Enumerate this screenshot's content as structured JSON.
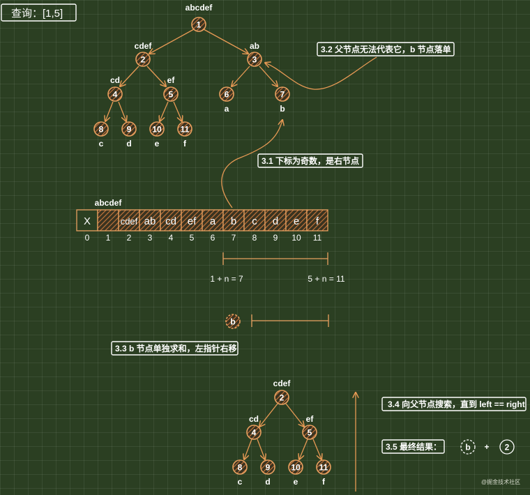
{
  "title": "查询：[1,5]",
  "tree_main": {
    "nodes": [
      {
        "id": "1",
        "label": "abcdef"
      },
      {
        "id": "2",
        "label": "cdef"
      },
      {
        "id": "3",
        "label": "ab"
      },
      {
        "id": "4",
        "label": "cd"
      },
      {
        "id": "5",
        "label": "ef"
      },
      {
        "id": "6",
        "label": "a"
      },
      {
        "id": "7",
        "label": "b"
      },
      {
        "id": "8",
        "label": "c"
      },
      {
        "id": "9",
        "label": "d"
      },
      {
        "id": "10",
        "label": "e"
      },
      {
        "id": "11",
        "label": "f"
      }
    ]
  },
  "array": {
    "cells": [
      {
        "value": "X",
        "index": "0"
      },
      {
        "value": "",
        "index": "1",
        "label_above": "abcdef"
      },
      {
        "value": "cdef",
        "index": "2"
      },
      {
        "value": "ab",
        "index": "3"
      },
      {
        "value": "cd",
        "index": "4"
      },
      {
        "value": "ef",
        "index": "5"
      },
      {
        "value": "a",
        "index": "6"
      },
      {
        "value": "b",
        "index": "7"
      },
      {
        "value": "c",
        "index": "8"
      },
      {
        "value": "d",
        "index": "9"
      },
      {
        "value": "e",
        "index": "10"
      },
      {
        "value": "f",
        "index": "11"
      }
    ]
  },
  "range": {
    "left_label": "1 + n = 7",
    "right_label": "5 + n = 11"
  },
  "b_node": {
    "label": "b"
  },
  "notes": {
    "n31": "3.1 下标为奇数，是右节点",
    "n32": "3.2 父节点无法代表它，b 节点落单",
    "n33": "3.3 b 节点单独求和，左指针右移",
    "n34": "3.4 向父节点搜索，直到 left == right",
    "n35": "3.5 最终结果："
  },
  "subtree": {
    "nodes": [
      {
        "id": "2",
        "label": "cdef"
      },
      {
        "id": "4",
        "label": "cd"
      },
      {
        "id": "5",
        "label": "ef"
      },
      {
        "id": "8",
        "label": "c"
      },
      {
        "id": "9",
        "label": "d"
      },
      {
        "id": "10",
        "label": "e"
      },
      {
        "id": "11",
        "label": "f"
      }
    ]
  },
  "result": {
    "left": "b",
    "op": "+",
    "right": "2"
  },
  "watermark": "@掘金技术社区"
}
